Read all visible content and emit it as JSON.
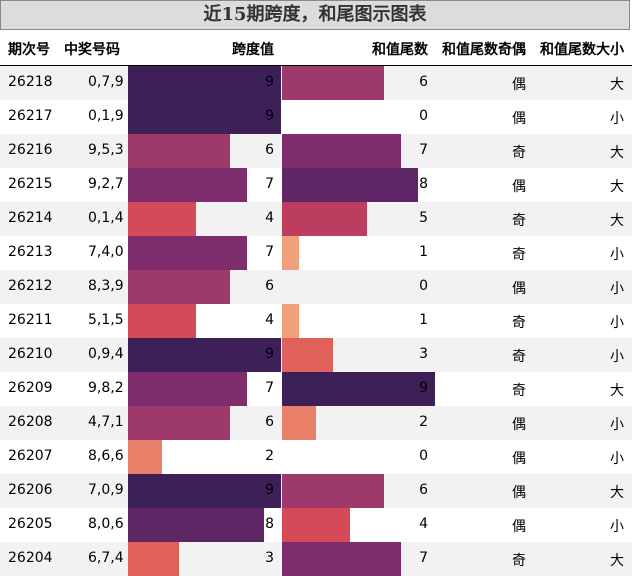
{
  "title": "近15期跨度，和尾图示图表",
  "chart_data": {
    "type": "table",
    "columns": [
      "期次号",
      "中奖号码",
      "跨度值",
      "和值尾数",
      "和值尾数奇偶",
      "和值尾数大小"
    ],
    "rows": [
      {
        "issue": "26218",
        "numbers": "0,7,9",
        "span": 9,
        "tail": 6,
        "parity": "偶",
        "size": "大"
      },
      {
        "issue": "26217",
        "numbers": "0,1,9",
        "span": 9,
        "tail": 0,
        "parity": "偶",
        "size": "小"
      },
      {
        "issue": "26216",
        "numbers": "9,5,3",
        "span": 6,
        "tail": 7,
        "parity": "奇",
        "size": "大"
      },
      {
        "issue": "26215",
        "numbers": "9,2,7",
        "span": 7,
        "tail": 8,
        "parity": "偶",
        "size": "大"
      },
      {
        "issue": "26214",
        "numbers": "0,1,4",
        "span": 4,
        "tail": 5,
        "parity": "奇",
        "size": "大"
      },
      {
        "issue": "26213",
        "numbers": "7,4,0",
        "span": 7,
        "tail": 1,
        "parity": "奇",
        "size": "小"
      },
      {
        "issue": "26212",
        "numbers": "8,3,9",
        "span": 6,
        "tail": 0,
        "parity": "偶",
        "size": "小"
      },
      {
        "issue": "26211",
        "numbers": "5,1,5",
        "span": 4,
        "tail": 1,
        "parity": "奇",
        "size": "小"
      },
      {
        "issue": "26210",
        "numbers": "0,9,4",
        "span": 9,
        "tail": 3,
        "parity": "奇",
        "size": "小"
      },
      {
        "issue": "26209",
        "numbers": "9,8,2",
        "span": 7,
        "tail": 9,
        "parity": "奇",
        "size": "大"
      },
      {
        "issue": "26208",
        "numbers": "4,7,1",
        "span": 6,
        "tail": 2,
        "parity": "偶",
        "size": "小"
      },
      {
        "issue": "26207",
        "numbers": "8,6,6",
        "span": 2,
        "tail": 0,
        "parity": "偶",
        "size": "小"
      },
      {
        "issue": "26206",
        "numbers": "7,0,9",
        "span": 9,
        "tail": 6,
        "parity": "偶",
        "size": "大"
      },
      {
        "issue": "26205",
        "numbers": "8,0,6",
        "span": 8,
        "tail": 4,
        "parity": "偶",
        "size": "小"
      },
      {
        "issue": "26204",
        "numbers": "6,7,4",
        "span": 3,
        "tail": 7,
        "parity": "奇",
        "size": "大"
      }
    ],
    "value_range": [
      0,
      9
    ],
    "palette": {
      "0": "#ffffff",
      "1": "#f0a07a",
      "2": "#e9816a",
      "3": "#e0605a",
      "4": "#d44a58",
      "5": "#bc3d60",
      "6": "#9e3a6b",
      "7": "#7e2d6c",
      "8": "#5e2664",
      "9": "#3e2058"
    }
  }
}
